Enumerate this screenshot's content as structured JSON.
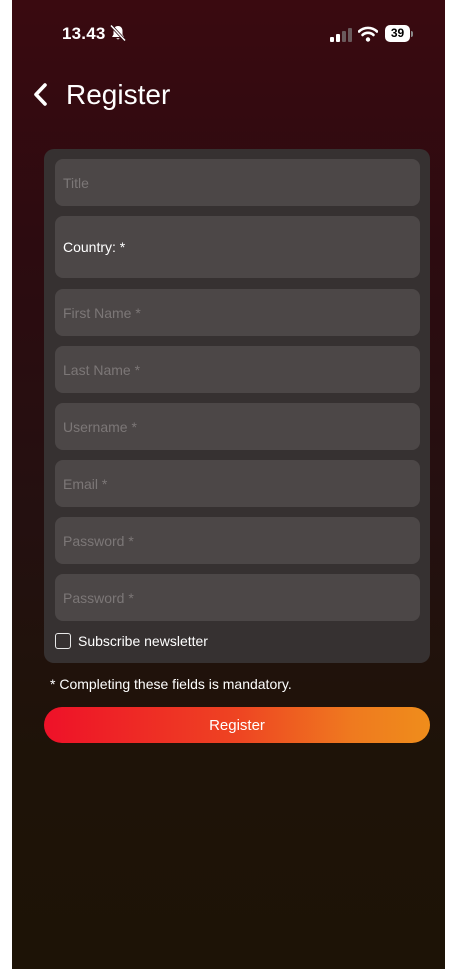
{
  "status_bar": {
    "time": "13.43",
    "battery": "39",
    "bell_icon": "bell-slash-icon",
    "signal_icon": "signal-icon",
    "wifi_icon": "wifi-icon"
  },
  "header": {
    "back_icon": "chevron-left-icon",
    "title": "Register"
  },
  "form": {
    "fields": [
      {
        "placeholder": "Title",
        "value": ""
      },
      {
        "label": "Country: *"
      },
      {
        "placeholder": "First Name *",
        "value": ""
      },
      {
        "placeholder": "Last Name *",
        "value": ""
      },
      {
        "placeholder": "Username *",
        "value": ""
      },
      {
        "placeholder": "Email *",
        "value": ""
      },
      {
        "placeholder": "Password *",
        "value": ""
      },
      {
        "placeholder": "Password *",
        "value": ""
      }
    ],
    "newsletter_label": "Subscribe newsletter",
    "newsletter_checked": false
  },
  "mandatory_note": "* Completing these fields is mandatory.",
  "register_button": "Register",
  "colors": {
    "button_gradient_start": "#ee1128",
    "button_gradient_end": "#ef8d1b",
    "card_background": "#363131",
    "field_background": "#4c4747",
    "placeholder_text": "#7c7777"
  }
}
